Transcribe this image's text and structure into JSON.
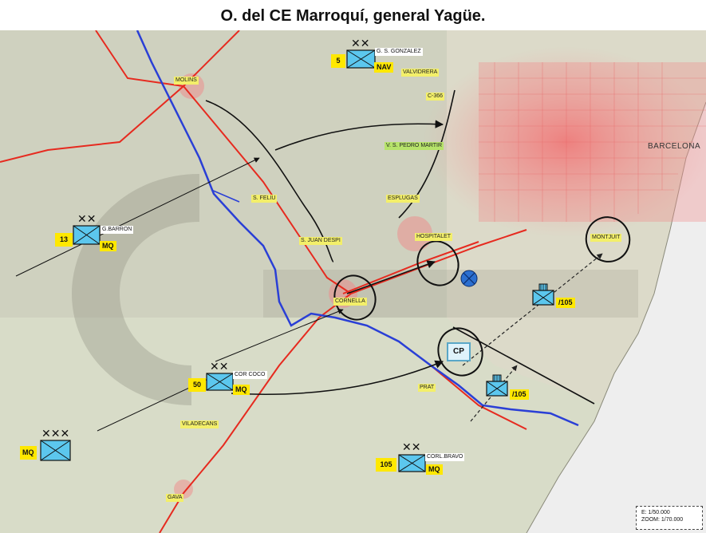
{
  "title": "O. del CE Marroquí, general Yagüe.",
  "places": {
    "molins": "MOLINS",
    "valvidrera": "VALVIDRERA",
    "c366": "C-366",
    "pedro_martir": "V. S. PEDRO MARTIR",
    "sfelin": "S. FELIU",
    "esplugas": "ESPLUGAS",
    "hospitalet": "HOSPITALET",
    "juan_despi": "S. JUAN DESPI",
    "cornella": "CORNELLA",
    "montjuit": "MONTJUIT",
    "prat": "PRAT",
    "viladecans": "VILADECANS",
    "gava": "GAVA",
    "barcelona": "BARCELONA"
  },
  "units": {
    "gonzalez": {
      "num": "5",
      "commander": "G. S. GONZALEZ",
      "tag": "NAV"
    },
    "barron": {
      "num": "13",
      "commander": "G.BARRON",
      "tag": "MQ"
    },
    "coco": {
      "num": "50",
      "commander": "COR COCO",
      "tag": "MQ"
    },
    "army": {
      "tag": "MQ"
    },
    "bravo": {
      "num": "105",
      "commander": "CORL.BRAVO",
      "tag": "MQ"
    },
    "cp": {
      "label": "CP"
    },
    "art1": {
      "tag": "/105"
    },
    "art2": {
      "tag": "/105"
    }
  },
  "scale": {
    "e": "E: 1/50.000",
    "zoom": "ZOOM: 1/70.000"
  },
  "colors": {
    "river": "#2a3fd6",
    "road": "#e62a1f",
    "arrow": "#111111",
    "unit_fill": "#5cc7ee",
    "unit_tag": "#ffe800"
  }
}
